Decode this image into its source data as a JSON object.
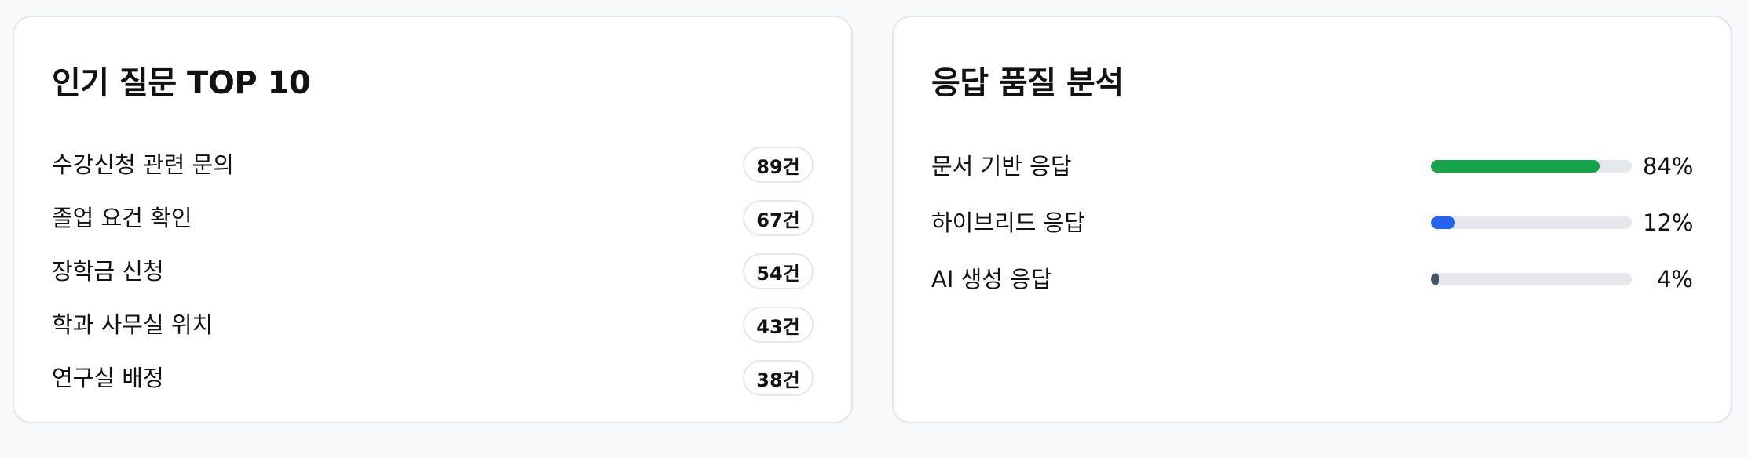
{
  "popular": {
    "title": "인기 질문 TOP 10",
    "items": [
      {
        "label": "수강신청 관련 문의",
        "count": "89건"
      },
      {
        "label": "졸업 요건 확인",
        "count": "67건"
      },
      {
        "label": "장학금 신청",
        "count": "54건"
      },
      {
        "label": "학과 사무실 위치",
        "count": "43건"
      },
      {
        "label": "연구실 배정",
        "count": "38건"
      }
    ]
  },
  "quality": {
    "title": "응답 품질 분석",
    "items": [
      {
        "label": "문서 기반 응답",
        "percent_text": "84%",
        "value": 84,
        "color": "#16a34a"
      },
      {
        "label": "하이브리드 응답",
        "percent_text": "12%",
        "value": 12,
        "color": "#2563eb"
      },
      {
        "label": "AI 생성 응답",
        "percent_text": "4%",
        "value": 4,
        "color": "#475569"
      }
    ]
  }
}
